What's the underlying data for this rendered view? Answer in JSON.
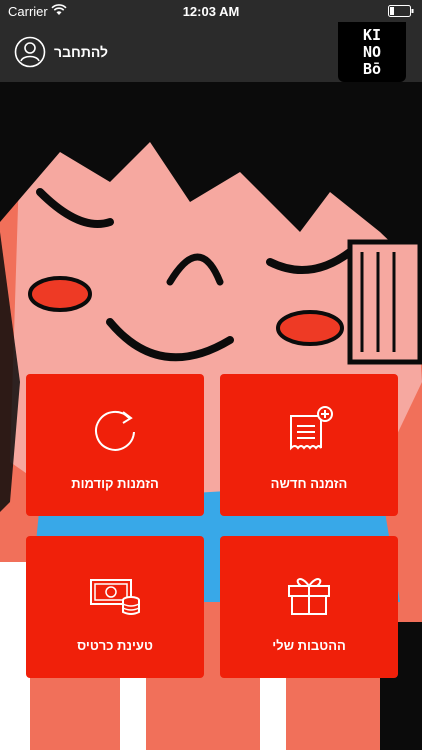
{
  "status_bar": {
    "carrier": "Carrier",
    "time": "12:03 AM"
  },
  "nav": {
    "login_label": "להתחבר",
    "logo_lines": [
      "KI",
      "NO",
      "Bō"
    ]
  },
  "menu": {
    "new_order": "הזמנה חדשה",
    "previous_orders": "הזמנות קודמות",
    "my_benefits": "ההטבות שלי",
    "card_load": "טעינת כרטיס"
  },
  "colors": {
    "tile": "#f0200a",
    "bar": "#2b2b2b",
    "hero": "#f1705a"
  }
}
